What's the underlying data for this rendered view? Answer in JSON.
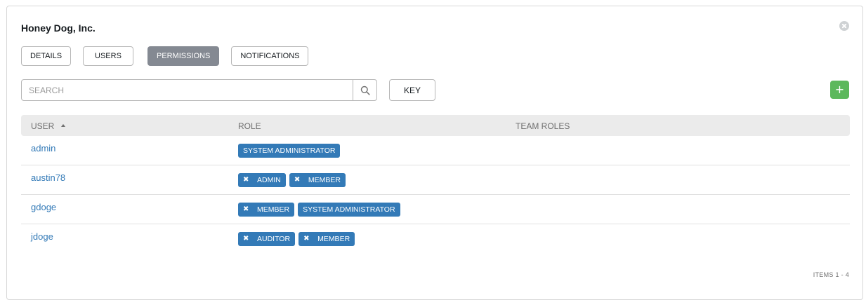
{
  "organization": {
    "title": "Honey Dog, Inc."
  },
  "tabs": [
    {
      "label": "DETAILS",
      "active": false
    },
    {
      "label": "USERS",
      "active": false
    },
    {
      "label": "PERMISSIONS",
      "active": true
    },
    {
      "label": "NOTIFICATIONS",
      "active": false
    }
  ],
  "toolbar": {
    "search_placeholder": "SEARCH",
    "key_label": "KEY",
    "add_label": "+"
  },
  "table": {
    "headers": {
      "user": "USER",
      "role": "ROLE",
      "team_roles": "TEAM ROLES"
    },
    "rows": [
      {
        "user": "admin",
        "roles": [
          {
            "label": "SYSTEM ADMINISTRATOR",
            "removable": false
          }
        ]
      },
      {
        "user": "austin78",
        "roles": [
          {
            "label": "ADMIN",
            "removable": true
          },
          {
            "label": "MEMBER",
            "removable": true
          }
        ]
      },
      {
        "user": "gdoge",
        "roles": [
          {
            "label": "MEMBER",
            "removable": true
          },
          {
            "label": "SYSTEM ADMINISTRATOR",
            "removable": false
          }
        ]
      },
      {
        "user": "jdoge",
        "roles": [
          {
            "label": "AUDITOR",
            "removable": true
          },
          {
            "label": "MEMBER",
            "removable": true
          }
        ]
      }
    ]
  },
  "footer": {
    "items_count": "ITEMS  1 - 4"
  },
  "colors": {
    "link": "#337ab7",
    "chip": "#337ab7",
    "active_tab": "#848992",
    "add_button": "#5cb85c"
  },
  "icons": {
    "close": "close-circle-icon",
    "search": "magnifier-icon",
    "sort": "caret-up-icon",
    "remove": "x-icon"
  }
}
